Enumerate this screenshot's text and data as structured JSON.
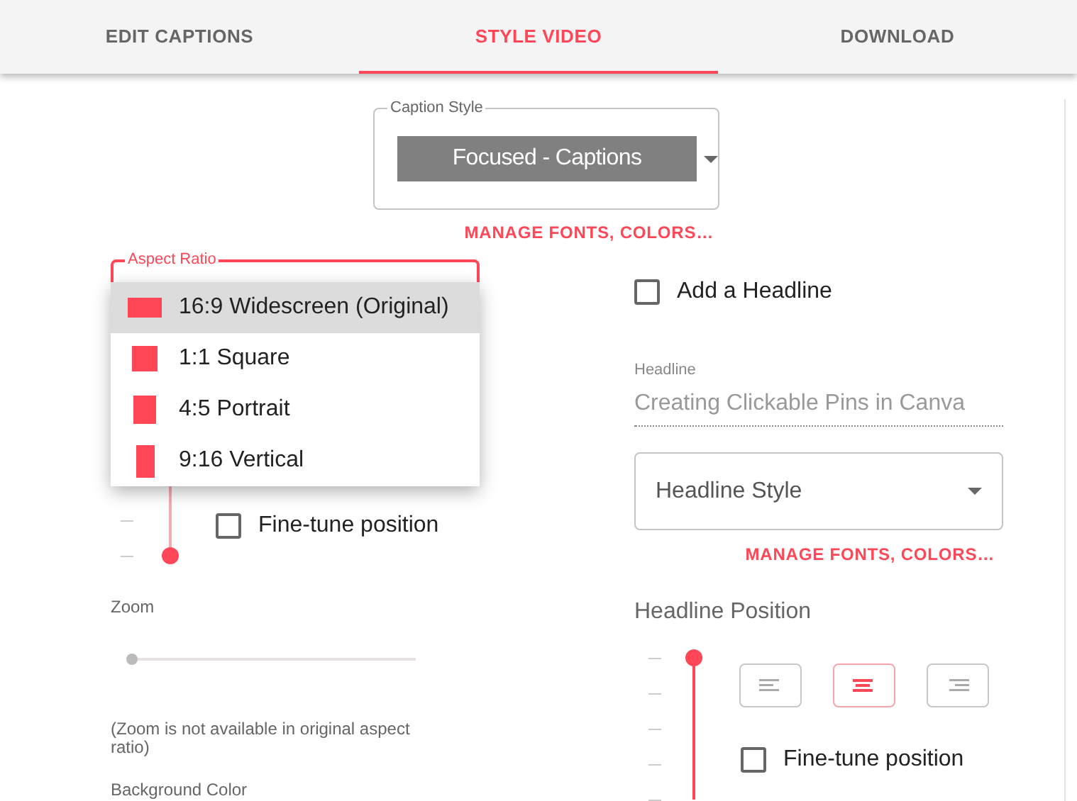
{
  "tabs": [
    {
      "label": "EDIT CAPTIONS",
      "selected": false
    },
    {
      "label": "STYLE VIDEO",
      "selected": true
    },
    {
      "label": "DOWNLOAD",
      "selected": false
    }
  ],
  "caption_style": {
    "label": "Caption Style",
    "value": "Focused - Captions",
    "link": "MANAGE FONTS, COLORS…"
  },
  "aspect_ratio": {
    "label": "Aspect Ratio",
    "expanded": true,
    "options": [
      {
        "label": "16:9 Widescreen (Original)",
        "kind": "widescreen",
        "selected": true
      },
      {
        "label": "1:1 Square",
        "kind": "square",
        "selected": false
      },
      {
        "label": "4:5 Portrait",
        "kind": "portrait",
        "selected": false
      },
      {
        "label": "9:16 Vertical",
        "kind": "vertical",
        "selected": false
      }
    ]
  },
  "video_position": {
    "level": 0,
    "fine_tune": {
      "label": "Fine-tune position",
      "checked": false
    }
  },
  "zoom": {
    "label": "Zoom",
    "level": 0,
    "disabled": true,
    "note": "(Zoom is not available in original aspect ratio)"
  },
  "background_color": {
    "label": "Background Color"
  },
  "headline": {
    "checkbox": {
      "label": "Add a Headline",
      "checked": false
    },
    "field": {
      "label": "Headline",
      "value": "Creating Clickable Pins in Canva",
      "disabled": true
    },
    "style_select": {
      "placeholder": "Headline Style"
    },
    "link": "MANAGE FONTS, COLORS…",
    "position": {
      "label": "Headline Position",
      "level": 1,
      "alignments": [
        {
          "kind": "left",
          "selected": false
        },
        {
          "kind": "center",
          "selected": true
        },
        {
          "kind": "right",
          "selected": false
        }
      ],
      "fine_tune": {
        "label": "Fine-tune position",
        "checked": false
      }
    }
  }
}
